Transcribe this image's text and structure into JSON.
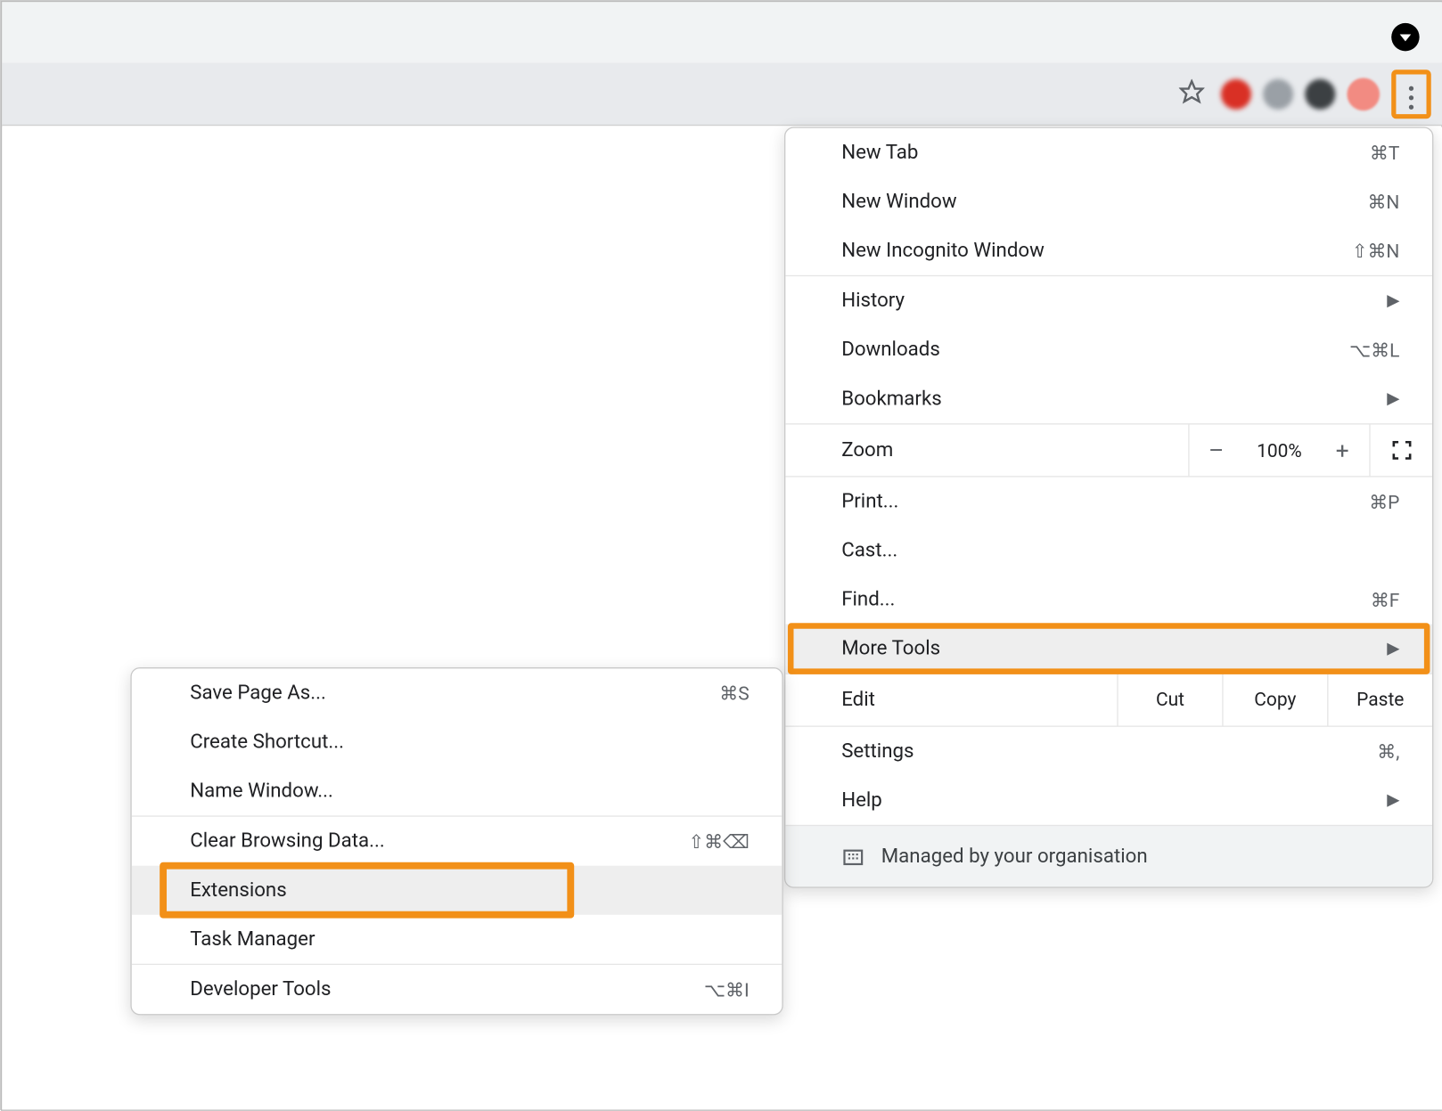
{
  "mainMenu": {
    "newTab": {
      "label": "New Tab",
      "shortcut": "⌘T"
    },
    "newWindow": {
      "label": "New Window",
      "shortcut": "⌘N"
    },
    "newIncognito": {
      "label": "New Incognito Window",
      "shortcut": "⇧⌘N"
    },
    "history": {
      "label": "History"
    },
    "downloads": {
      "label": "Downloads",
      "shortcut": "⌥⌘L"
    },
    "bookmarks": {
      "label": "Bookmarks"
    },
    "zoom": {
      "label": "Zoom",
      "value": "100%",
      "minus": "–",
      "plus": "+"
    },
    "print": {
      "label": "Print...",
      "shortcut": "⌘P"
    },
    "cast": {
      "label": "Cast..."
    },
    "find": {
      "label": "Find...",
      "shortcut": "⌘F"
    },
    "moreTools": {
      "label": "More Tools"
    },
    "edit": {
      "label": "Edit",
      "cut": "Cut",
      "copy": "Copy",
      "paste": "Paste"
    },
    "settings": {
      "label": "Settings",
      "shortcut": "⌘,"
    },
    "help": {
      "label": "Help"
    },
    "managed": {
      "label": "Managed by your organisation"
    }
  },
  "subMenu": {
    "savePage": {
      "label": "Save Page As...",
      "shortcut": "⌘S"
    },
    "createShortcut": {
      "label": "Create Shortcut..."
    },
    "nameWindow": {
      "label": "Name Window..."
    },
    "clearBrowsing": {
      "label": "Clear Browsing Data...",
      "shortcut": "⇧⌘⌫"
    },
    "extensions": {
      "label": "Extensions"
    },
    "taskManager": {
      "label": "Task Manager"
    },
    "devTools": {
      "label": "Developer Tools",
      "shortcut": "⌥⌘I"
    }
  }
}
